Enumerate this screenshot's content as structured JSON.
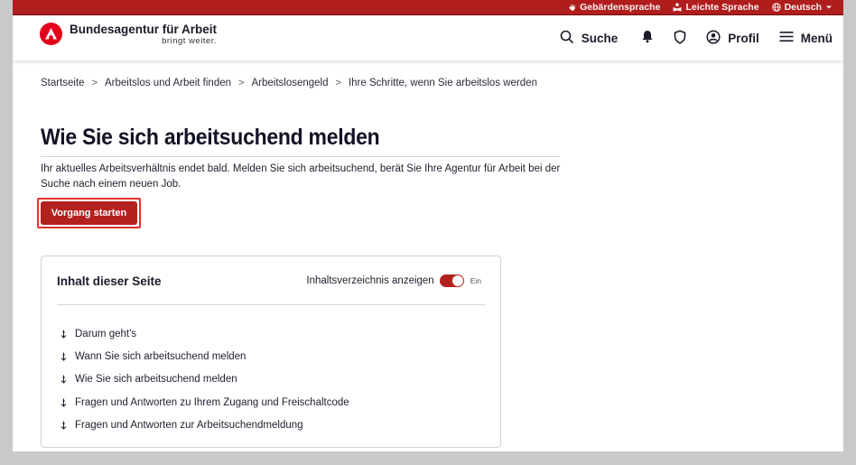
{
  "utility_bar": {
    "items": [
      {
        "label": "Gebärdensprache",
        "icon": "hand-icon"
      },
      {
        "label": "Leichte Sprache",
        "icon": "reading-icon"
      },
      {
        "label": "Deutsch",
        "icon": "globe-icon"
      }
    ],
    "accent": "#b01d1d"
  },
  "header": {
    "logo_name": "Bundesagentur für Arbeit",
    "logo_claim": "bringt weiter.",
    "nav": {
      "search_label": "Suche",
      "profile_label": "Profil",
      "menu_label": "Menü"
    }
  },
  "breadcrumb": [
    "Startseite",
    "Arbeitslos und Arbeit finden",
    "Arbeitslosengeld",
    "Ihre Schritte, wenn Sie arbeitslos werden"
  ],
  "main": {
    "title": "Wie Sie sich arbeitsuchend melden",
    "intro": "Ihr aktuelles Arbeitsverhältnis endet bald. Melden Sie sich arbeitsuchend, berät Sie Ihre Agentur für Arbeit bei der Suche nach einem neuen Job.",
    "cta_label": "Vorgang starten",
    "cta_color": "#b3211f",
    "highlight_color": "#e4322b"
  },
  "toc": {
    "title": "Inhalt dieser Seite",
    "toggle_label": "Inhaltsverzeichnis anzeigen",
    "toggle_state": "Ein",
    "items": [
      "Darum geht’s",
      "Wann Sie sich arbeitsuchend melden",
      "Wie Sie sich arbeitsuchend melden",
      "Fragen und Antworten zu Ihrem Zugang und Freischaltcode",
      "Fragen und Antworten zur Arbeitsuchendmeldung"
    ]
  }
}
